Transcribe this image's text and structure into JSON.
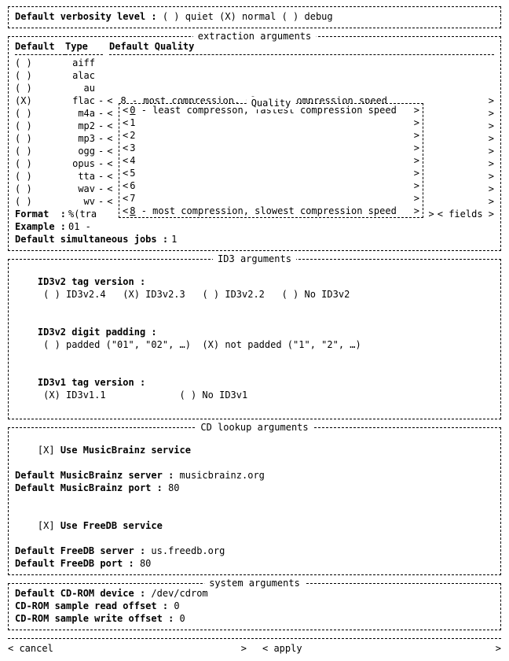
{
  "verbosity": {
    "label": "Default verbosity level :",
    "options": [
      {
        "label": "quiet",
        "selected": false
      },
      {
        "label": "normal",
        "selected": true
      },
      {
        "label": "debug",
        "selected": false
      }
    ]
  },
  "extraction": {
    "title": "extraction arguments",
    "headers": {
      "default": "Default",
      "type": "Type",
      "quality": "Default Quality"
    },
    "types": [
      {
        "name": "aiff",
        "selected": false,
        "has_quality": false
      },
      {
        "name": "alac",
        "selected": false,
        "has_quality": false
      },
      {
        "name": "au",
        "selected": false,
        "has_quality": false
      },
      {
        "name": "flac",
        "selected": true,
        "has_quality": true,
        "quality_text": "8 - most compression, slowest compression speed"
      },
      {
        "name": "m4a",
        "selected": false,
        "has_quality": true,
        "quality_text": ""
      },
      {
        "name": "mp2",
        "selected": false,
        "has_quality": true,
        "quality_text": ""
      },
      {
        "name": "mp3",
        "selected": false,
        "has_quality": true,
        "quality_text": ""
      },
      {
        "name": "ogg",
        "selected": false,
        "has_quality": true,
        "quality_text": ""
      },
      {
        "name": "opus",
        "selected": false,
        "has_quality": true,
        "quality_text": ""
      },
      {
        "name": "tta",
        "selected": false,
        "has_quality": true,
        "quality_text": ""
      },
      {
        "name": "wav",
        "selected": false,
        "has_quality": true,
        "quality_text": ""
      },
      {
        "name": "wv",
        "selected": false,
        "has_quality": true,
        "quality_text": ""
      }
    ],
    "format": {
      "label": "Format",
      "value": "%(tra"
    },
    "fields_btn": "< fields >",
    "example": {
      "label": "Example",
      "value": "01 -"
    },
    "jobs": {
      "label": "Default simultaneous jobs :",
      "value": "1"
    }
  },
  "quality_popup": {
    "title": "Quality",
    "options": [
      {
        "value": "0",
        "text": "0 - least compresson, fastest compression speed",
        "focus": true
      },
      {
        "value": "1",
        "text": "1"
      },
      {
        "value": "2",
        "text": "2"
      },
      {
        "value": "3",
        "text": "3"
      },
      {
        "value": "4",
        "text": "4"
      },
      {
        "value": "5",
        "text": "5"
      },
      {
        "value": "6",
        "text": "6"
      },
      {
        "value": "7",
        "text": "7"
      },
      {
        "value": "8",
        "text": "8 - most compression, slowest compression speed",
        "selected": true
      }
    ]
  },
  "id3": {
    "title": "ID3 arguments",
    "v2_label": "ID3v2 tag version :",
    "v2_options": [
      {
        "label": "ID3v2.4",
        "selected": false
      },
      {
        "label": "ID3v2.3",
        "selected": true
      },
      {
        "label": "ID3v2.2",
        "selected": false
      },
      {
        "label": "No ID3v2",
        "selected": false
      }
    ],
    "pad_label": "ID3v2 digit padding :",
    "pad_options": [
      {
        "label": "padded (\"01\", \"02\", …)",
        "selected": false
      },
      {
        "label": "not padded (\"1\", \"2\", …)",
        "selected": true
      }
    ],
    "v1_label": "ID3v1 tag version :",
    "v1_options": [
      {
        "label": "ID3v1.1",
        "selected": true
      },
      {
        "label": "No ID3v1",
        "selected": false
      }
    ]
  },
  "cd_lookup": {
    "title": "CD lookup arguments",
    "mb_use_label": "Use MusicBrainz service",
    "mb_use": true,
    "mb_server_label": "Default MusicBrainz server :",
    "mb_server": "musicbrainz.org",
    "mb_port_label": "Default MusicBrainz port :",
    "mb_port": "80",
    "fdb_use_label": "Use FreeDB service",
    "fdb_use": true,
    "fdb_server_label": "Default FreeDB server :",
    "fdb_server": "us.freedb.org",
    "fdb_port_label": "Default FreeDB port :",
    "fdb_port": "80"
  },
  "system": {
    "title": "system arguments",
    "dev_label": "Default CD-ROM device :",
    "dev": "/dev/cdrom",
    "roff_label": "CD-ROM sample read offset :",
    "roff": "0",
    "woff_label": "CD-ROM sample write offset :",
    "woff": "0"
  },
  "bottom": {
    "cancel": "cancel",
    "apply": "apply"
  }
}
